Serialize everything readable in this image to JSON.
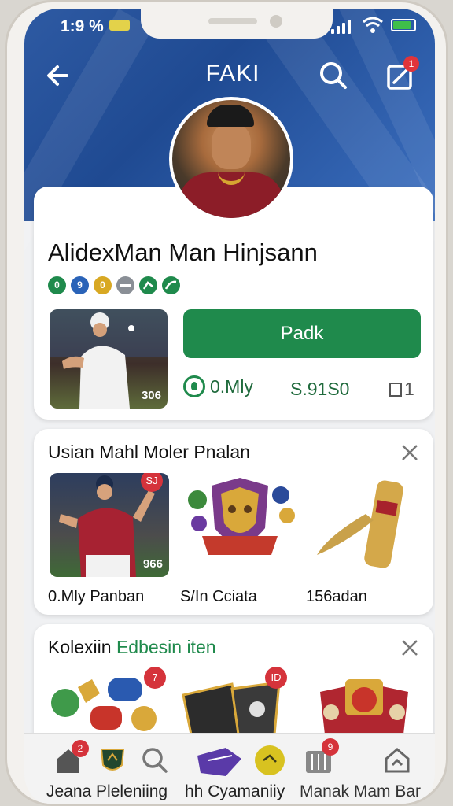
{
  "status": {
    "time": "1:9 %"
  },
  "header": {
    "title": "FAKI",
    "notification_count": "1"
  },
  "profile": {
    "name": "AlidexMan Man Hinjsann",
    "badges": [
      "0",
      "9",
      "0",
      "",
      "",
      ""
    ],
    "photo_caption": "306",
    "primary_button": "Padk",
    "stat_left": "0.Mly",
    "stat_middle": "S.91S0",
    "stat_right": "1"
  },
  "section1": {
    "title": "Usian Mahl Moler Pnalan",
    "tiles": [
      {
        "label": "0.Mly Panban",
        "caption": "966",
        "badge": "SJ"
      },
      {
        "label": "S/In Cciata",
        "caption": ""
      },
      {
        "label": "156adan",
        "caption": ""
      }
    ]
  },
  "section2": {
    "title": "Kolexiin",
    "title_accent": "Edbesin iten",
    "tile_badges": [
      "7",
      "ID"
    ]
  },
  "nav": {
    "items": [
      {
        "label": "Jeana Pleleniing",
        "badge": "2"
      },
      {
        "label": "hh Cyamaniiy"
      },
      {
        "label": "Manak Mam Bar",
        "badge": "9"
      }
    ]
  },
  "colors": {
    "brand_green": "#1f8a4c",
    "header_blue": "#2e5aa3",
    "badge_red": "#d5333b"
  }
}
